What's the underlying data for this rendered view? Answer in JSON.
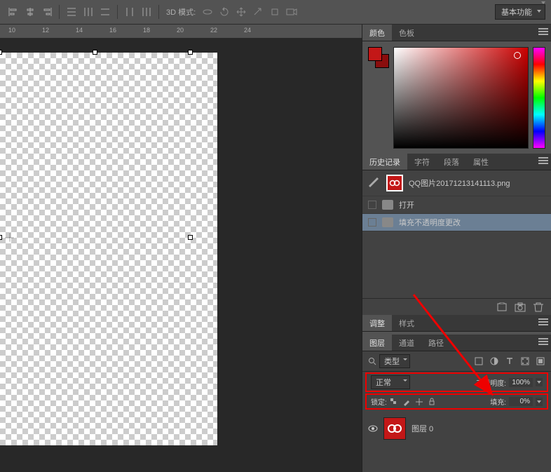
{
  "toolbar": {
    "mode_label": "3D 模式:",
    "workspace": "基本功能"
  },
  "ruler": {
    "marks": [
      "10",
      "12",
      "14",
      "16",
      "18",
      "20",
      "22",
      "24"
    ]
  },
  "panels": {
    "color_tab": "颜色",
    "swatches_tab": "色板",
    "history_tab": "历史记录",
    "char_tab": "字符",
    "para_tab": "段落",
    "props_tab": "属性",
    "adjust_tab": "调整",
    "styles_tab": "样式",
    "layers_tab": "图层",
    "channels_tab": "通道",
    "paths_tab": "路径",
    "history_file": "QQ图片20171213141113.png",
    "history_step1": "打开",
    "history_step2": "填充不透明度更改",
    "layer_kind": "类型",
    "blend_mode": "正常",
    "opacity_label": "不透明度:",
    "opacity_value": "100%",
    "lock_label": "锁定:",
    "fill_label": "填充:",
    "fill_value": "0%",
    "layer0_name": "图层 0"
  }
}
